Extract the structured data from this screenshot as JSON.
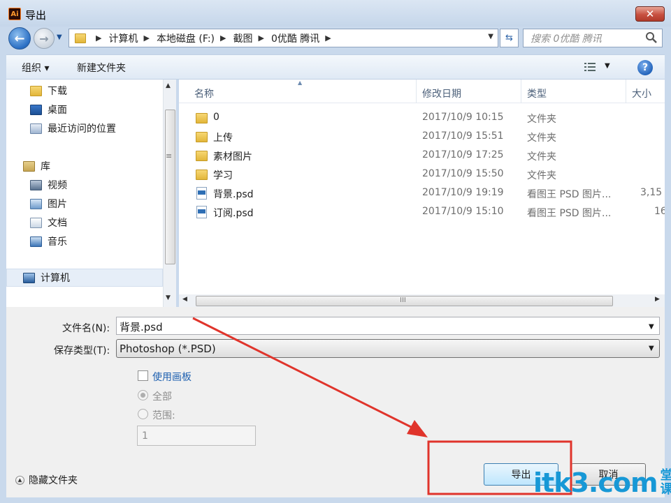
{
  "window": {
    "title": "导出",
    "app_icon": "Ai",
    "close_glyph": "✕"
  },
  "address": {
    "crumbs": [
      "计算机",
      "本地磁盘 (F:)",
      "截图",
      "0优酷 腾讯"
    ],
    "search_placeholder": "搜索 0优酷 腾讯"
  },
  "toolbar": {
    "organize": "组织 ▾",
    "new_folder": "新建文件夹"
  },
  "nav": {
    "items": [
      {
        "label": "下载",
        "icon": "downloads-icon"
      },
      {
        "label": "桌面",
        "icon": "desktop-icon"
      },
      {
        "label": "最近访问的位置",
        "icon": "recent-places-icon"
      },
      {
        "label": "库",
        "icon": "library-icon"
      },
      {
        "label": "视频",
        "icon": "videos-icon"
      },
      {
        "label": "图片",
        "icon": "pictures-icon"
      },
      {
        "label": "文档",
        "icon": "documents-icon"
      },
      {
        "label": "音乐",
        "icon": "music-icon"
      },
      {
        "label": "计算机",
        "icon": "computer-icon"
      }
    ]
  },
  "columns": {
    "name": "名称",
    "date": "修改日期",
    "type": "类型",
    "size": "大小"
  },
  "files": [
    {
      "name": "0",
      "date": "2017/10/9 10:15",
      "type": "文件夹",
      "size": "",
      "kind": "folder"
    },
    {
      "name": "上传",
      "date": "2017/10/9 15:51",
      "type": "文件夹",
      "size": "",
      "kind": "folder"
    },
    {
      "name": "素材图片",
      "date": "2017/10/9 17:25",
      "type": "文件夹",
      "size": "",
      "kind": "folder"
    },
    {
      "name": "学习",
      "date": "2017/10/9 15:50",
      "type": "文件夹",
      "size": "",
      "kind": "folder"
    },
    {
      "name": "背景.psd",
      "date": "2017/10/9 19:19",
      "type": "看图王 PSD 图片...",
      "size": "3,15",
      "kind": "psd"
    },
    {
      "name": "订阅.psd",
      "date": "2017/10/9 15:10",
      "type": "看图王 PSD 图片...",
      "size": "16",
      "kind": "psd"
    }
  ],
  "form": {
    "filename_label": "文件名(N):",
    "filename_value": "背景.psd",
    "type_label": "保存类型(T):",
    "type_value": "Photoshop (*.PSD)",
    "artboard_label": "使用画板",
    "radio_all_label": "全部",
    "radio_range_label": "范围:",
    "range_value": "1",
    "hide_folders": "隐藏文件夹",
    "export_button": "导出",
    "cancel_button": "取消"
  },
  "watermark": {
    "main": "itk3.com",
    "side_top": "堂课",
    "side_bottom": ""
  },
  "colors": {
    "annotation": "#e0342b",
    "watermark": "#1798d6",
    "accent": "#1f61b0"
  }
}
